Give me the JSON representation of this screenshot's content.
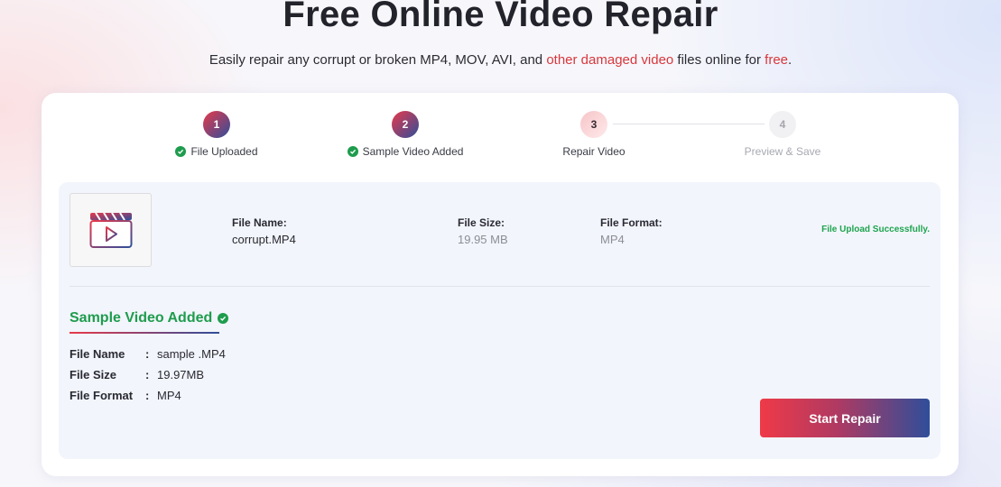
{
  "header": {
    "title": "Free Online Video Repair",
    "subtitle_part1": "Easily repair any corrupt or broken MP4, MOV, AVI, and ",
    "subtitle_highlight1": "other damaged video",
    "subtitle_part2": " files online for ",
    "subtitle_highlight2": "free",
    "subtitle_end": "."
  },
  "steps": [
    {
      "number": "1",
      "label": "File Uploaded",
      "state": "done"
    },
    {
      "number": "2",
      "label": "Sample Video Added",
      "state": "done"
    },
    {
      "number": "3",
      "label": "Repair Video",
      "state": "current"
    },
    {
      "number": "4",
      "label": "Preview & Save",
      "state": "todo"
    }
  ],
  "file": {
    "name_label": "File Name:",
    "name": "corrupt.MP4",
    "size_label": "File Size:",
    "size": "19.95 MB",
    "format_label": "File Format:",
    "format": "MP4",
    "status": "File Upload Successfully."
  },
  "sample": {
    "heading": "Sample Video Added",
    "rows": [
      {
        "key": "File Name",
        "sep": ":",
        "value": "sample .MP4"
      },
      {
        "key": "File Size",
        "sep": ":",
        "value": "19.97MB"
      },
      {
        "key": "File Format",
        "sep": ":",
        "value": "MP4"
      }
    ]
  },
  "actions": {
    "start_repair": "Start Repair"
  },
  "colors": {
    "accent_red": "#e8394a",
    "accent_blue": "#2f4e9a",
    "success_green": "#1e9c4d"
  }
}
